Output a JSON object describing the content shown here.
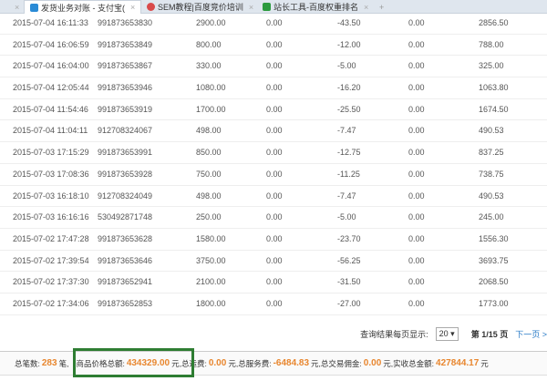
{
  "tabs": [
    {
      "label": "发货业务对账 - 支付宝(",
      "active": true,
      "color": "#2a8bd6"
    },
    {
      "label": "SEM教程|百度竞价培训",
      "active": false,
      "color": "#d94a4a"
    },
    {
      "label": "站长工具-百度权重排名",
      "active": false,
      "color": "#2b9a3e"
    }
  ],
  "new_tab": "+",
  "rows": [
    [
      "2015-07-04 16:11:33",
      "991873653830",
      "2900.00",
      "0.00",
      "-43.50",
      "0.00",
      "2856.50"
    ],
    [
      "2015-07-04 16:06:59",
      "991873653849",
      "800.00",
      "0.00",
      "-12.00",
      "0.00",
      "788.00"
    ],
    [
      "2015-07-04 16:04:00",
      "991873653867",
      "330.00",
      "0.00",
      "-5.00",
      "0.00",
      "325.00"
    ],
    [
      "2015-07-04 12:05:44",
      "991873653946",
      "1080.00",
      "0.00",
      "-16.20",
      "0.00",
      "1063.80"
    ],
    [
      "2015-07-04 11:54:46",
      "991873653919",
      "1700.00",
      "0.00",
      "-25.50",
      "0.00",
      "1674.50"
    ],
    [
      "2015-07-04 11:04:11",
      "912708324067",
      "498.00",
      "0.00",
      "-7.47",
      "0.00",
      "490.53"
    ],
    [
      "2015-07-03 17:15:29",
      "991873653991",
      "850.00",
      "0.00",
      "-12.75",
      "0.00",
      "837.25"
    ],
    [
      "2015-07-03 17:08:36",
      "991873653928",
      "750.00",
      "0.00",
      "-11.25",
      "0.00",
      "738.75"
    ],
    [
      "2015-07-03 16:18:10",
      "912708324049",
      "498.00",
      "0.00",
      "-7.47",
      "0.00",
      "490.53"
    ],
    [
      "2015-07-03 16:16:16",
      "530492871748",
      "250.00",
      "0.00",
      "-5.00",
      "0.00",
      "245.00"
    ],
    [
      "2015-07-02 17:47:28",
      "991873653628",
      "1580.00",
      "0.00",
      "-23.70",
      "0.00",
      "1556.30"
    ],
    [
      "2015-07-02 17:39:54",
      "991873653646",
      "3750.00",
      "0.00",
      "-56.25",
      "0.00",
      "3693.75"
    ],
    [
      "2015-07-02 17:37:30",
      "991873652941",
      "2100.00",
      "0.00",
      "-31.50",
      "0.00",
      "2068.50"
    ],
    [
      "2015-07-02 17:34:06",
      "991873652853",
      "1800.00",
      "0.00",
      "-27.00",
      "0.00",
      "1773.00"
    ]
  ],
  "pager": {
    "label": "查询结果每页显示:",
    "page_size": "20 ▾",
    "page_info": "第 1/15 页",
    "next": "下一页 >"
  },
  "summary": {
    "count_label": "总笔数:",
    "count": "283",
    "count_unit": "笔,",
    "price_label": "商品价格总额:",
    "price": "434329.00",
    "price_unit": "元,",
    "freight_label": "总运费:",
    "freight": "0.00",
    "freight_unit": "元,",
    "service_label": "总服务费:",
    "service": "-6484.83",
    "service_unit": "元,",
    "commission_label": "总交易佣金:",
    "commission": "0.00",
    "commission_unit": "元,",
    "received_label": "实收总金额:",
    "received": "427844.17",
    "received_unit": "元"
  }
}
